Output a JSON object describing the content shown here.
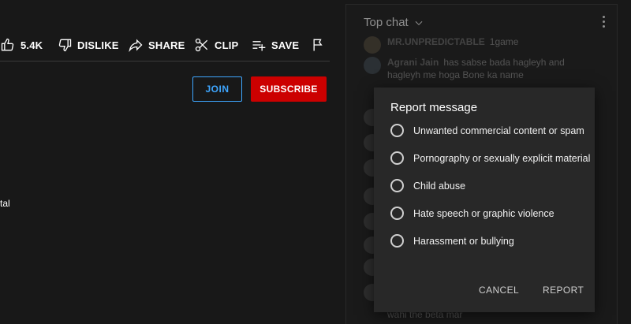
{
  "actions": {
    "like_count": "5.4K",
    "dislike_label": "DISLIKE",
    "share_label": "SHARE",
    "clip_label": "CLIP",
    "save_label": "SAVE"
  },
  "channel": {
    "join_label": "JOIN",
    "subscribe_label": "SUBSCRIBE"
  },
  "description": {
    "fragment": "tal"
  },
  "chat": {
    "header": "Top chat",
    "messages": [
      {
        "author": "MR.UNPREDICTABLE",
        "text": "1game"
      },
      {
        "author": "Agrani Jain",
        "text": "has sabse bada hagleyh and"
      },
      {
        "author": "",
        "text": "hagleyh me hoga Bone ka name"
      },
      {
        "author": "",
        "text": "wahi the beta mar"
      }
    ]
  },
  "dialog": {
    "title": "Report message",
    "options": [
      "Unwanted commercial content or spam",
      "Pornography or sexually explicit material",
      "Child abuse",
      "Hate speech or graphic violence",
      "Harassment or bullying"
    ],
    "cancel_label": "CANCEL",
    "report_label": "REPORT"
  },
  "colors": {
    "subscribe": "#cc0000",
    "join": "#3ea6ff",
    "dialog_bg": "#282828"
  }
}
